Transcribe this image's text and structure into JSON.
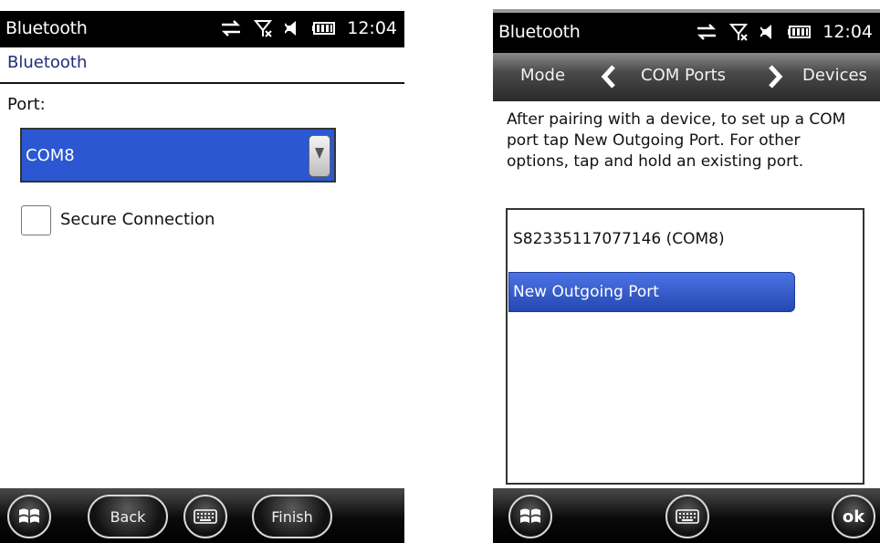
{
  "left_screen": {
    "status": {
      "title": "Bluetooth",
      "time": "12:04",
      "icons": [
        "sync-icon",
        "no-signal-icon",
        "speaker-icon",
        "battery-icon"
      ]
    },
    "subtitle": "Bluetooth",
    "port_label": "Port:",
    "port_select": {
      "value": "COM8",
      "selected_bg": "#2b57d2"
    },
    "secure_checkbox": {
      "label": "Secure Connection",
      "checked": false
    },
    "bottom": {
      "back_label": "Back",
      "finish_label": "Finish",
      "icons": [
        "windows-start-icon",
        "keyboard-icon"
      ]
    }
  },
  "right_screen": {
    "status": {
      "title": "Bluetooth",
      "time": "12:04",
      "icons": [
        "sync-icon",
        "no-signal-icon",
        "speaker-icon",
        "battery-icon"
      ]
    },
    "nav": {
      "left": "Mode",
      "center": "COM Ports",
      "right": "Devices"
    },
    "instructions": "After pairing with a device, to set up a COM port tap New Outgoing Port. For other options, tap and hold an existing port.",
    "ports": [
      {
        "label": "S82335117077146 (COM8)"
      }
    ],
    "new_port_label": "New Outgoing Port",
    "bottom": {
      "ok_label": "ok",
      "icons": [
        "windows-start-icon",
        "keyboard-icon"
      ]
    }
  },
  "accent_color": "#2b57d2"
}
